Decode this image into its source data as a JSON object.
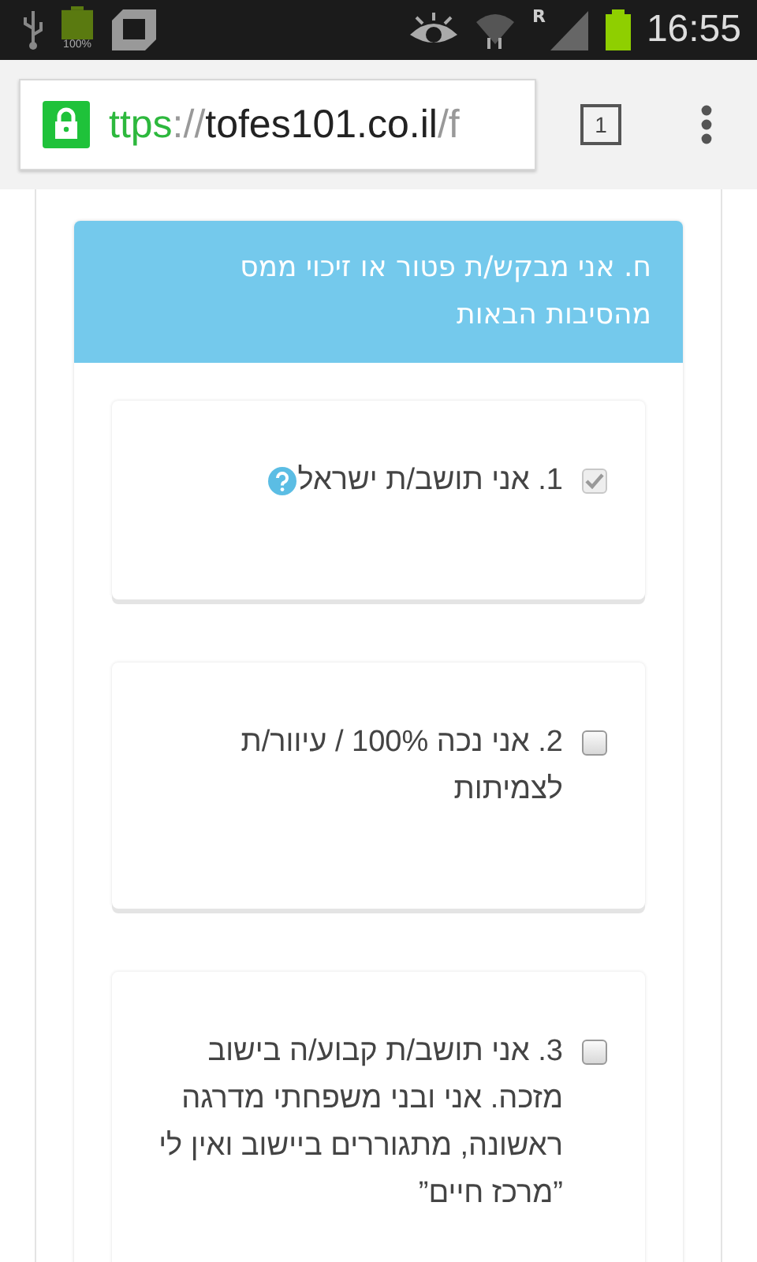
{
  "status_bar": {
    "battery_label": "100%",
    "network_label": "R",
    "time": "16:55"
  },
  "browser": {
    "url": {
      "scheme": "ttps",
      "separator": "://",
      "host": "tofes101.co.il",
      "path": "/f"
    },
    "tab_count": "1"
  },
  "section": {
    "title": "ח. אני מבקש/ת פטור או זיכוי ממס מהסיבות הבאות",
    "items": [
      {
        "label": "1. אני תושב/ת ישראל",
        "checked": true,
        "disabled": true,
        "has_help": true
      },
      {
        "label": "2. אני נכה 100% / עיוור/ת לצמיתות",
        "checked": false,
        "disabled": false,
        "has_help": false
      },
      {
        "label": "3. אני תושב/ת קבוע/ה בישוב מזכה. אני ובני משפחתי מדרגה ראשונה, מתגוררים ביישוב ואין לי ”מרכז חיים”",
        "checked": false,
        "disabled": false,
        "has_help": false
      }
    ]
  }
}
